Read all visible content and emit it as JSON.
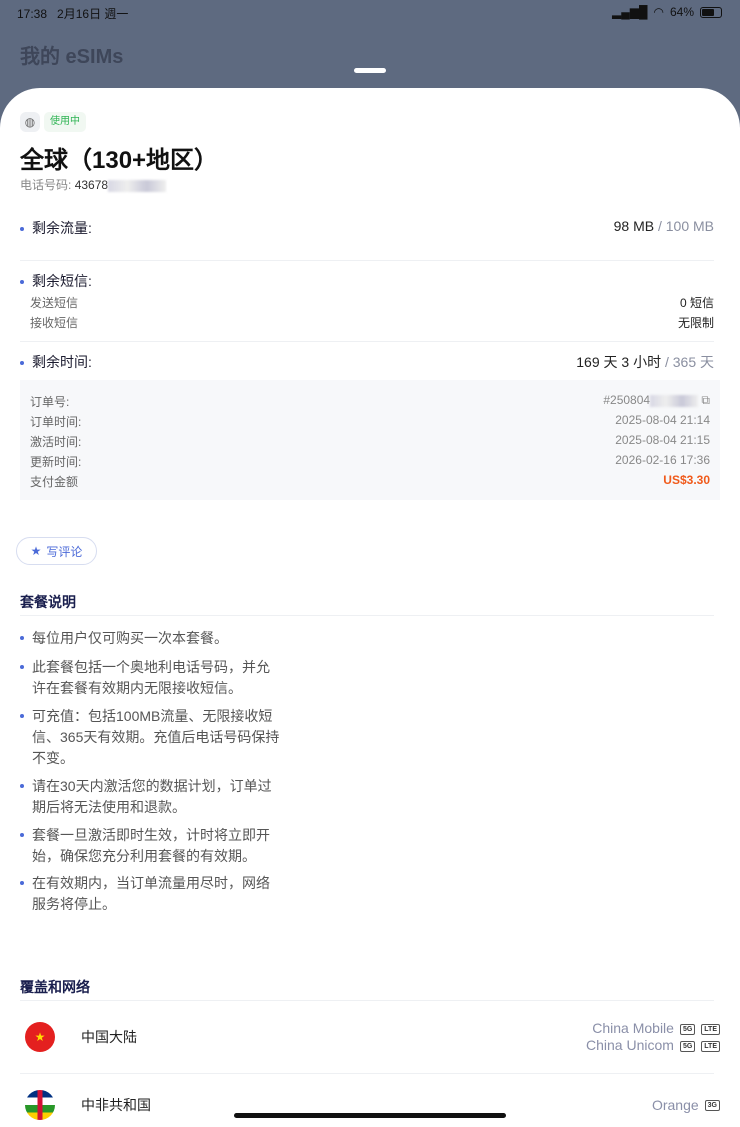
{
  "status": {
    "time": "17:38",
    "date": "2月16日 週一",
    "battery": "64%"
  },
  "background_title": "我的 eSIMs",
  "esim": {
    "status": "使用中",
    "title": "全球（130+地区）",
    "phone_label": "电话号码:",
    "phone_value": "43678"
  },
  "usage": {
    "data_label": "剩余流量:",
    "data_remaining": "98 MB",
    "data_total": " / 100 MB",
    "sms_label": "剩余短信:",
    "send_label": "发送短信",
    "send_value": "0 短信",
    "receive_label": "接收短信",
    "receive_value": "无限制",
    "time_label": "剩余时间:",
    "time_remaining": "169 天 3 小时",
    "time_total": " / 365 天"
  },
  "order": {
    "rows": [
      {
        "label": "订单号:",
        "value": "#250804"
      },
      {
        "label": "订单时间:",
        "value": "2025-08-04 21:14"
      },
      {
        "label": "激活时间:",
        "value": "2025-08-04 21:15"
      },
      {
        "label": "更新时间:",
        "value": "2026-02-16 17:36"
      },
      {
        "label": "支付金额",
        "value": "US$3.30"
      }
    ]
  },
  "review_button": "写评论",
  "plan": {
    "title": "套餐说明",
    "items": [
      "每位用户仅可购买一次本套餐。",
      "此套餐包括一个奥地利电话号码，并允许在套餐有效期内无限接收短信。",
      "可充值：包括100MB流量、无限接收短信、365天有效期。充值后电话号码保持不变。",
      "请在30天内激活您的数据计划，订单过期后将无法使用和退款。",
      "套餐一旦激活即时生效，计时将立即开始，确保您充分利用套餐的有效期。",
      "在有效期内，当订单流量用尽时，网络服务将停止。"
    ]
  },
  "coverage": {
    "title": "覆盖和网络",
    "countries": [
      {
        "name": "中国大陆",
        "operators": [
          {
            "name": "China Mobile",
            "tags": [
              "5G",
              "LTE"
            ]
          },
          {
            "name": "China Unicom",
            "tags": [
              "5G",
              "LTE"
            ]
          }
        ]
      },
      {
        "name": "中非共和国",
        "operators": [
          {
            "name": "Orange",
            "tags": [
              "3G"
            ]
          }
        ]
      }
    ]
  },
  "colors": {
    "accent": "#4b6ad8",
    "price": "#f05a1a",
    "active": "#2fb454"
  }
}
